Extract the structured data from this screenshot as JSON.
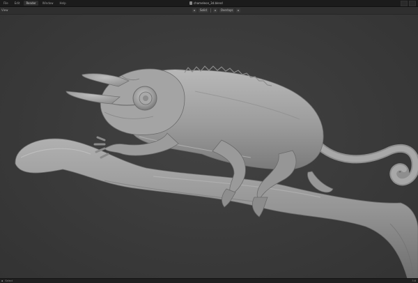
{
  "menu": {
    "items": [
      "File",
      "Edit",
      "Render",
      "Window",
      "Help"
    ],
    "active_index": 3
  },
  "window": {
    "title": "chameleon_3d.blend"
  },
  "toolbar": {
    "view_label": "View",
    "shading_label": "Solid",
    "overlay_label": "Overlays"
  },
  "status": {
    "left_icon": "mouse-icon",
    "left_text": "Select",
    "right_text": "3.6"
  },
  "viewport": {
    "subject": "chameleon sculpt",
    "background_color": "#3a3a3a",
    "model_color": "#9c9c9c"
  }
}
